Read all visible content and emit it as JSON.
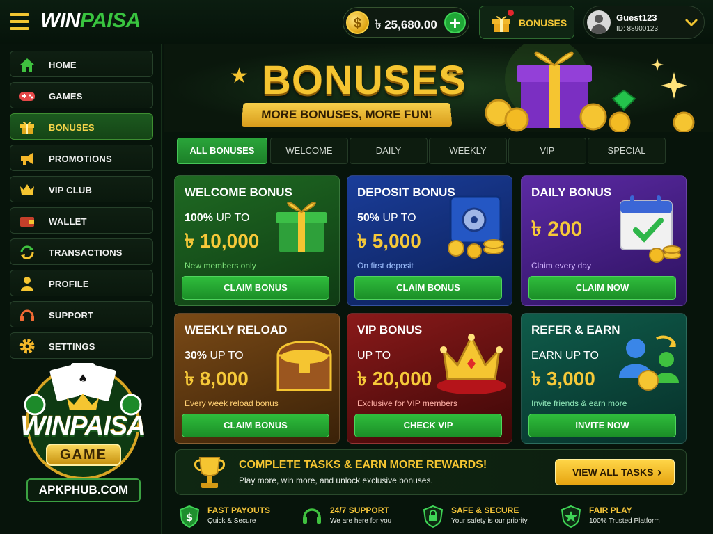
{
  "header": {
    "logo_part1": "WIN",
    "logo_part2": "PAISA",
    "balance": "৳ 25,680.00",
    "coin_symbol": "$",
    "add_label": "+",
    "bonuses_label": "BONUSES",
    "user_name": "Guest123",
    "user_id": "ID: 88900123"
  },
  "sidebar": {
    "items": [
      {
        "label": "HOME",
        "icon": "home-icon"
      },
      {
        "label": "GAMES",
        "icon": "gamepad-icon"
      },
      {
        "label": "BONUSES",
        "icon": "gift-icon",
        "active": true
      },
      {
        "label": "PROMOTIONS",
        "icon": "megaphone-icon"
      },
      {
        "label": "VIP CLUB",
        "icon": "crown-icon"
      },
      {
        "label": "WALLET",
        "icon": "wallet-icon"
      },
      {
        "label": "TRANSACTIONS",
        "icon": "refresh-icon"
      },
      {
        "label": "PROFILE",
        "icon": "user-icon"
      },
      {
        "label": "SUPPORT",
        "icon": "headset-icon"
      },
      {
        "label": "SETTINGS",
        "icon": "gear-icon"
      }
    ],
    "promo_title": "WINPAISA",
    "promo_subtitle": "GAME",
    "promo_site": "APKPHUB.COM"
  },
  "banner": {
    "title": "BONUSES",
    "ribbon": "MORE BONUSES, MORE FUN!"
  },
  "tabs": [
    "ALL BONUSES",
    "WELCOME",
    "DAILY",
    "WEEKLY",
    "VIP",
    "SPECIAL"
  ],
  "cards": [
    {
      "title": "WELCOME BONUS",
      "pct": "100%",
      "up_to": "UP TO",
      "amount": "৳ 10,000",
      "note": "New members only",
      "button": "CLAIM BONUS"
    },
    {
      "title": "DEPOSIT BONUS",
      "pct": "50%",
      "up_to": "UP TO",
      "amount": "৳ 5,000",
      "note": "On first deposit",
      "button": "CLAIM BONUS"
    },
    {
      "title": "DAILY BONUS",
      "amount": "৳ 200",
      "note": "Claim every day",
      "button": "CLAIM NOW"
    },
    {
      "title": "WEEKLY RELOAD",
      "pct": "30%",
      "up_to": "UP TO",
      "amount": "৳ 8,000",
      "note": "Every week reload bonus",
      "button": "CLAIM BONUS"
    },
    {
      "title": "VIP BONUS",
      "up_to": "UP TO",
      "amount": "৳ 20,000",
      "note": "Exclusive for VIP members",
      "button": "CHECK VIP"
    },
    {
      "title": "REFER & EARN",
      "up_to": "EARN UP TO",
      "amount": "৳ 3,000",
      "note": "Invite friends & earn more",
      "button": "INVITE NOW"
    }
  ],
  "tasks": {
    "title": "COMPLETE TASKS & EARN MORE REWARDS!",
    "subtitle": "Play more, win more, and unlock exclusive bonuses.",
    "button": "VIEW ALL TASKS",
    "chevron": "›"
  },
  "features": [
    {
      "title": "FAST PAYOUTS",
      "sub": "Quick & Secure",
      "icon": "dollar-shield-icon"
    },
    {
      "title": "24/7 SUPPORT",
      "sub": "We are here for you",
      "icon": "headset-icon"
    },
    {
      "title": "SAFE & SECURE",
      "sub": "Your safety is our priority",
      "icon": "lock-shield-icon"
    },
    {
      "title": "FAIR PLAY",
      "sub": "100% Trusted Platform",
      "icon": "star-shield-icon"
    }
  ],
  "colors": {
    "accent_gold": "#f5c531",
    "accent_green": "#2aa53a",
    "background": "#07140b"
  }
}
